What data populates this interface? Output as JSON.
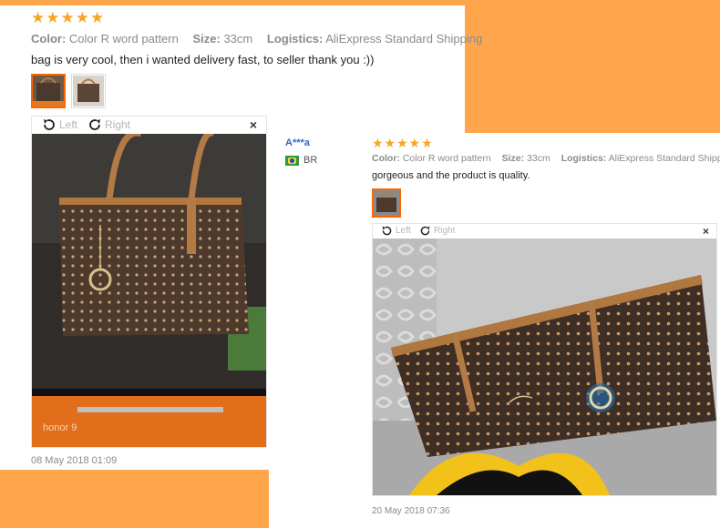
{
  "review1": {
    "stars": "★★★★★",
    "color_label": "Color:",
    "color_value": "Color R word pattern",
    "size_label": "Size:",
    "size_value": "33cm",
    "logistics_label": "Logistics:",
    "logistics_value": "AliExpress Standard Shipping",
    "text": "bag is very cool, then i wanted delivery fast, to seller thank you :))",
    "viewer": {
      "left_label": "Left",
      "right_label": "Right",
      "close": "×"
    },
    "photo_brand_text": "honor 9",
    "date": "08 May 2018 01:09"
  },
  "reviewer2": {
    "name": "A***a",
    "country": "BR"
  },
  "review2": {
    "stars": "★★★★★",
    "color_label": "Color:",
    "color_value": "Color R word pattern",
    "size_label": "Size:",
    "size_value": "33cm",
    "logistics_label": "Logistics:",
    "logistics_value": "AliExpress Standard Shipping",
    "text": "gorgeous and the product is quality.",
    "viewer": {
      "left_label": "Left",
      "right_label": "Right",
      "close": "×"
    },
    "date": "20 May 2018 07:36"
  },
  "colors": {
    "background": "#ffa64d",
    "star": "#f5a623",
    "active_thumb": "#ff6600",
    "username": "#3366cc"
  }
}
